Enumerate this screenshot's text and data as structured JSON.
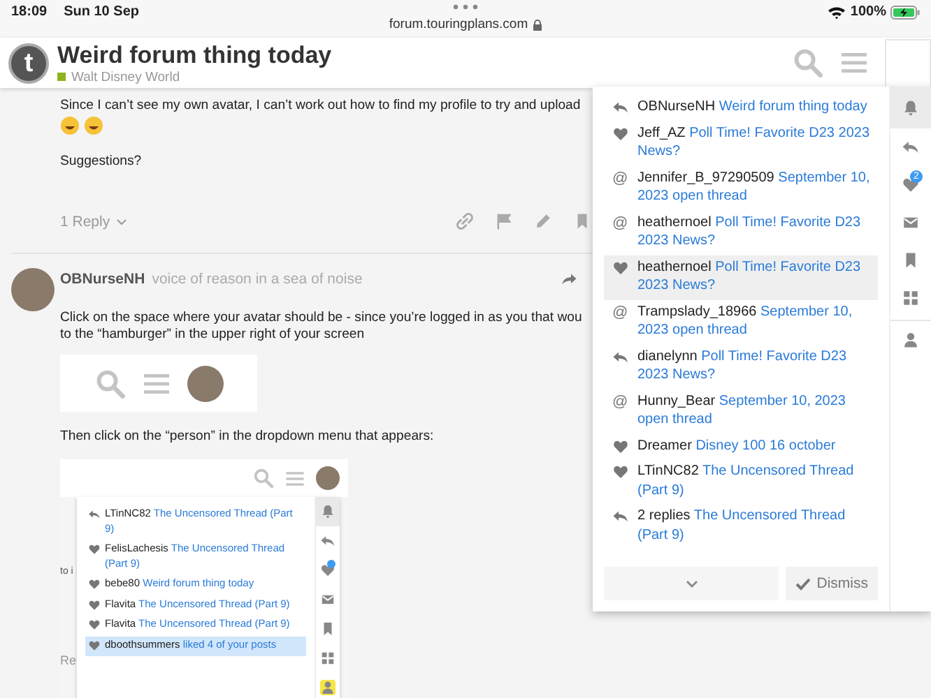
{
  "status_bar": {
    "time": "18:09",
    "date": "Sun 10 Sep",
    "url": "forum.touringplans.com",
    "battery": "100%"
  },
  "header": {
    "logo_letter": "t",
    "title": "Weird forum thing today",
    "category": "Walt Disney World"
  },
  "first_post": {
    "line": "Since I can’t see my own avatar, I can’t work out how to find my profile to try and upload",
    "question": "Suggestions?",
    "replies": "1 Reply"
  },
  "reply_post": {
    "author": "OBNurseNH",
    "user_title": "voice of reason in a sea of noise",
    "lines": [
      "Click on the space where your avatar should be - since you’re logged in as you that wou",
      "to the “hamburger” in the upper right of your screen"
    ],
    "then": "Then click on the “person” in the dropdown menu that appears:",
    "screenshot": {
      "behind_texts": [
        "to i",
        "Re"
      ],
      "notifications": [
        {
          "kind": "reply",
          "user": "LTinNC82",
          "topic": "The Uncensored Thread (Part 9)",
          "selected": false
        },
        {
          "kind": "like",
          "user": "FelisLachesis",
          "topic": "The Uncensored Thread (Part 9)",
          "selected": false
        },
        {
          "kind": "like",
          "user": "bebe80",
          "topic": "Weird forum thing today",
          "selected": false
        },
        {
          "kind": "like",
          "user": "Flavita",
          "topic": "The Uncensored Thread (Part 9)",
          "selected": false
        },
        {
          "kind": "like",
          "user": "Flavita",
          "topic": "The Uncensored Thread (Part 9)",
          "selected": false
        },
        {
          "kind": "like",
          "user": "dboothsummers",
          "topic": "liked 4 of your posts",
          "selected": true
        }
      ],
      "tabs": [
        {
          "kind": "bell",
          "selected": true,
          "highlighted": false
        },
        {
          "kind": "reply",
          "selected": false,
          "highlighted": false
        },
        {
          "kind": "like",
          "selected": false,
          "highlighted": false,
          "badge": true
        },
        {
          "kind": "message",
          "selected": false,
          "highlighted": false
        },
        {
          "kind": "bookmark",
          "selected": false,
          "highlighted": false
        },
        {
          "kind": "grid",
          "selected": false,
          "highlighted": false
        },
        {
          "kind": "profile",
          "selected": false,
          "highlighted": true
        }
      ]
    }
  },
  "panel": {
    "notifications": [
      {
        "kind": "reply",
        "user": "OBNurseNH",
        "topic": "Weird forum thing today",
        "selected": false
      },
      {
        "kind": "like",
        "user": "Jeff_AZ",
        "topic": "Poll Time! Favorite D23 2023 News?",
        "selected": false
      },
      {
        "kind": "mention",
        "symbol": "@",
        "user": "Jennifer_B_97290509",
        "topic": "September 10, 2023 open thread",
        "selected": false
      },
      {
        "kind": "mention",
        "symbol": "@",
        "user": "heathernoel",
        "topic": "Poll Time! Favorite D23 2023 News?",
        "selected": false
      },
      {
        "kind": "like",
        "user": "heathernoel",
        "topic": "Poll Time! Favorite D23 2023 News?",
        "selected": true
      },
      {
        "kind": "mention",
        "symbol": "@",
        "user": "Trampslady_18966",
        "topic": "September 10, 2023 open thread",
        "selected": false
      },
      {
        "kind": "reply",
        "user": "dianelynn",
        "topic": "Poll Time! Favorite D23 2023 News?",
        "selected": false
      },
      {
        "kind": "mention",
        "symbol": "@",
        "user": "Hunny_Bear",
        "topic": "September 10, 2023 open thread",
        "selected": false
      },
      {
        "kind": "like",
        "user": "Dreamer",
        "topic": "Disney 100 16 october",
        "selected": false
      },
      {
        "kind": "like",
        "user": "LTinNC82",
        "topic": "The Uncensored Thread (Part 9)",
        "selected": false
      },
      {
        "kind": "reply",
        "user": "2 replies",
        "topic": "The Uncensored Thread (Part 9)",
        "selected": false
      }
    ],
    "dismiss": "Dismiss",
    "tabs": [
      {
        "kind": "bell",
        "selected": true
      },
      {
        "kind": "reply",
        "selected": false
      },
      {
        "kind": "like",
        "selected": false,
        "badge": "2"
      },
      {
        "kind": "message",
        "selected": false
      },
      {
        "kind": "bookmark",
        "selected": false
      },
      {
        "kind": "grid",
        "selected": false
      },
      {
        "kind": "profile",
        "selected": false
      }
    ]
  }
}
